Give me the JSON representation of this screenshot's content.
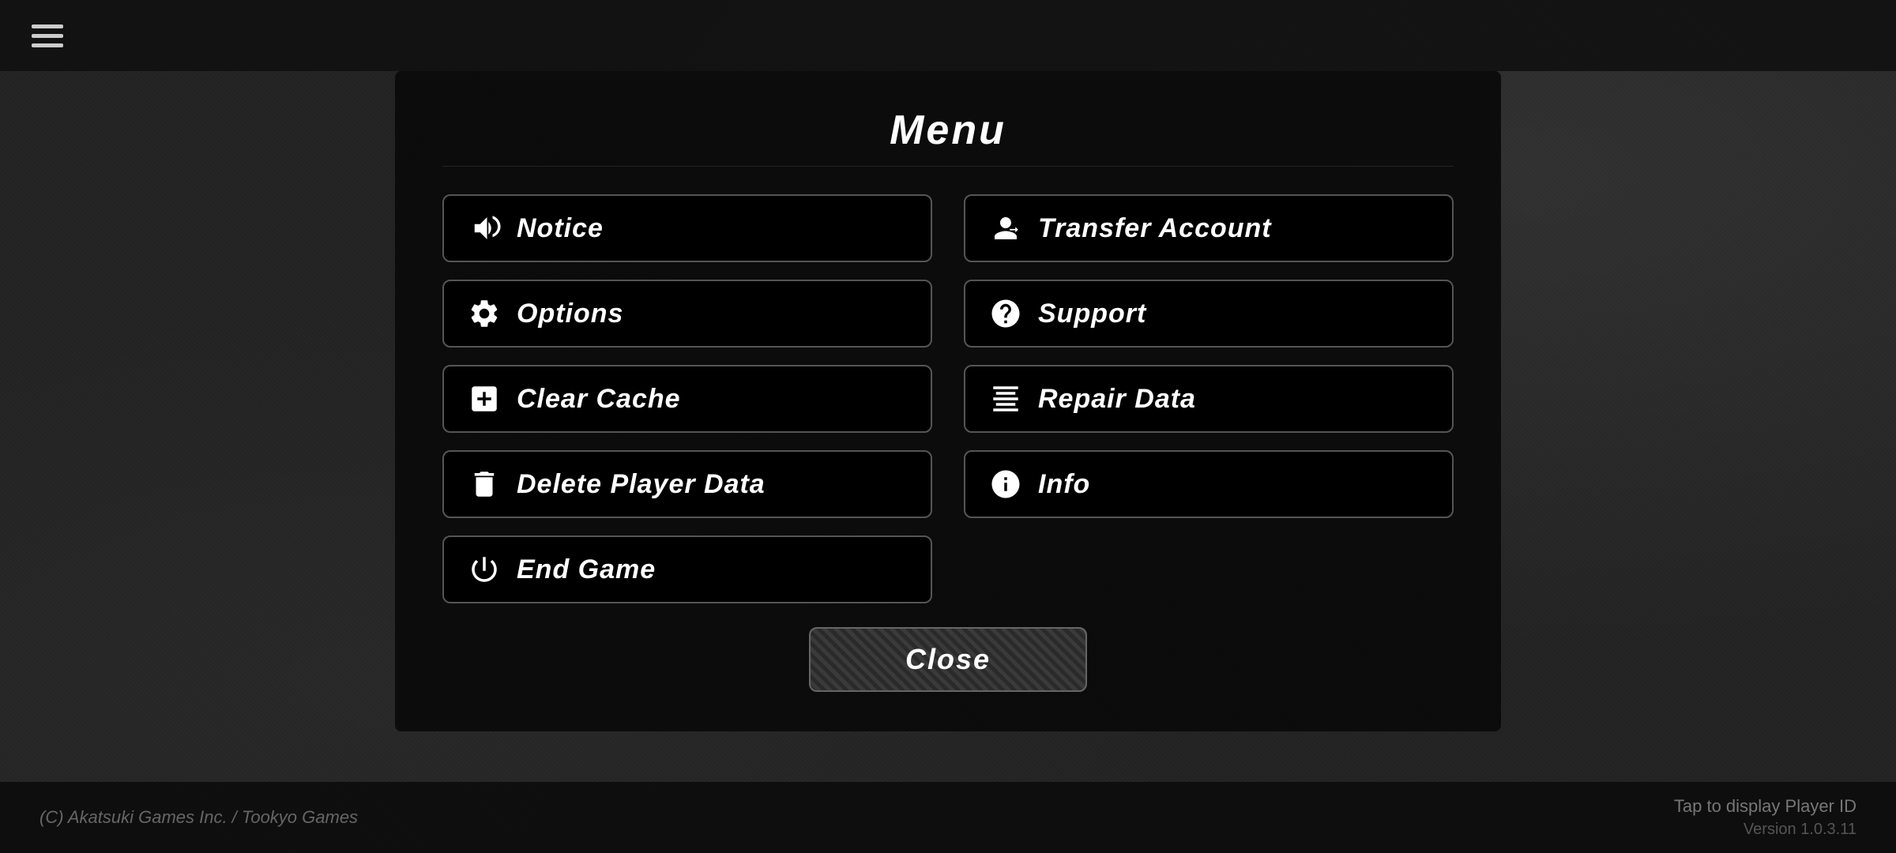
{
  "topBar": {
    "hamburgerLabel": "menu"
  },
  "menu": {
    "title": "Menu",
    "buttons": [
      {
        "id": "notice",
        "label": "Notice",
        "icon": "megaphone",
        "col": 1
      },
      {
        "id": "transfer-account",
        "label": "Transfer Account",
        "icon": "transfer",
        "col": 2
      },
      {
        "id": "options",
        "label": "Options",
        "icon": "gear",
        "col": 1
      },
      {
        "id": "support",
        "label": "Support",
        "icon": "question",
        "col": 2
      },
      {
        "id": "clear-cache",
        "label": "Clear Cache",
        "icon": "cache",
        "col": 1
      },
      {
        "id": "repair-data",
        "label": "Repair Data",
        "icon": "repair",
        "col": 2
      },
      {
        "id": "delete-player-data",
        "label": "Delete Player Data",
        "icon": "trash",
        "col": 1
      },
      {
        "id": "info",
        "label": "Info",
        "icon": "info",
        "col": 2
      },
      {
        "id": "end-game",
        "label": "End Game",
        "icon": "power",
        "col": 1
      }
    ],
    "closeButton": "Close"
  },
  "bottomBar": {
    "copyright": "(C) Akatsuki Games Inc. / Tookyo Games",
    "tapPlayerId": "Tap to display Player ID",
    "version": "Version 1.0.3.11"
  }
}
